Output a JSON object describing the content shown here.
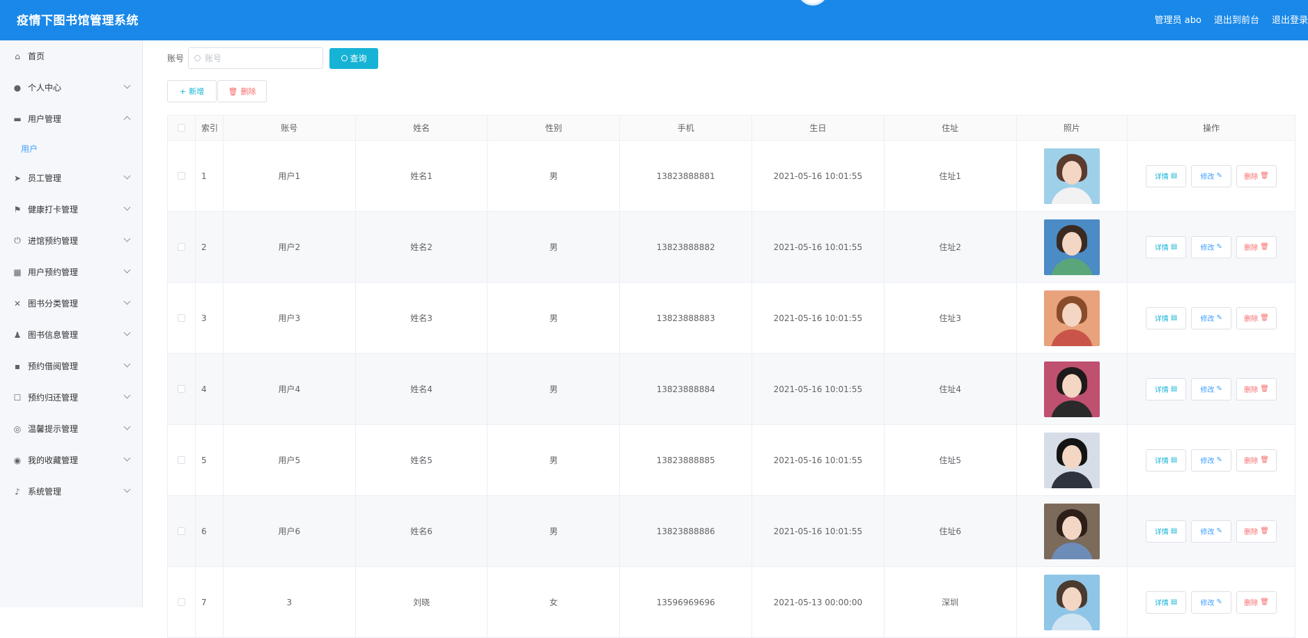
{
  "header": {
    "title": "疫情下图书馆管理系统",
    "admin": "管理员 abo",
    "to_front": "退出到前台",
    "logout": "退出登录"
  },
  "sidebar": {
    "items": [
      {
        "label": "首页",
        "icon": "home-icon",
        "has_chevron": false
      },
      {
        "label": "个人中心",
        "icon": "user-icon",
        "has_chevron": true
      },
      {
        "label": "用户管理",
        "icon": "id-card-icon",
        "has_chevron": true,
        "expanded": true
      },
      {
        "label": "员工管理",
        "icon": "send-icon",
        "has_chevron": true
      },
      {
        "label": "健康打卡管理",
        "icon": "flag-icon",
        "has_chevron": true
      },
      {
        "label": "进馆预约管理",
        "icon": "power-icon",
        "has_chevron": true
      },
      {
        "label": "用户预约管理",
        "icon": "grid-icon",
        "has_chevron": true
      },
      {
        "label": "图书分类管理",
        "icon": "bell-off-icon",
        "has_chevron": true
      },
      {
        "label": "图书信息管理",
        "icon": "stamp-icon",
        "has_chevron": true
      },
      {
        "label": "预约借阅管理",
        "icon": "menu-icon",
        "has_chevron": true
      },
      {
        "label": "预约归还管理",
        "icon": "chat-icon",
        "has_chevron": true
      },
      {
        "label": "温馨提示管理",
        "icon": "aim-icon",
        "has_chevron": true
      },
      {
        "label": "我的收藏管理",
        "icon": "compass-icon",
        "has_chevron": true
      },
      {
        "label": "系统管理",
        "icon": "mic-icon",
        "has_chevron": true
      }
    ],
    "subitem": "用户"
  },
  "search": {
    "label": "账号",
    "placeholder": "账号",
    "button": "查询"
  },
  "actions": {
    "add": "新增",
    "delete": "删除"
  },
  "table": {
    "headers": [
      "索引",
      "账号",
      "姓名",
      "性别",
      "手机",
      "生日",
      "住址",
      "照片",
      "操作"
    ],
    "rows": [
      {
        "idx": "1",
        "account": "用户1",
        "name": "姓名1",
        "gender": "男",
        "phone": "13823888881",
        "birthday": "2021-05-16 10:01:55",
        "address": "住址1"
      },
      {
        "idx": "2",
        "account": "用户2",
        "name": "姓名2",
        "gender": "男",
        "phone": "13823888882",
        "birthday": "2021-05-16 10:01:55",
        "address": "住址2"
      },
      {
        "idx": "3",
        "account": "用户3",
        "name": "姓名3",
        "gender": "男",
        "phone": "13823888883",
        "birthday": "2021-05-16 10:01:55",
        "address": "住址3"
      },
      {
        "idx": "4",
        "account": "用户4",
        "name": "姓名4",
        "gender": "男",
        "phone": "13823888884",
        "birthday": "2021-05-16 10:01:55",
        "address": "住址4"
      },
      {
        "idx": "5",
        "account": "用户5",
        "name": "姓名5",
        "gender": "男",
        "phone": "13823888885",
        "birthday": "2021-05-16 10:01:55",
        "address": "住址5"
      },
      {
        "idx": "6",
        "account": "用户6",
        "name": "姓名6",
        "gender": "男",
        "phone": "13823888886",
        "birthday": "2021-05-16 10:01:55",
        "address": "住址6"
      },
      {
        "idx": "7",
        "account": "3",
        "name": "刘晓",
        "gender": "女",
        "phone": "13596969696",
        "birthday": "2021-05-13 00:00:00",
        "address": "深圳"
      }
    ],
    "ops": {
      "detail": "详情",
      "edit": "修改",
      "delete": "删除"
    }
  },
  "colors": {
    "header_bg": "#1988e8",
    "accent": "#17b3d6",
    "link": "#409eff",
    "danger": "#f56c6c"
  }
}
